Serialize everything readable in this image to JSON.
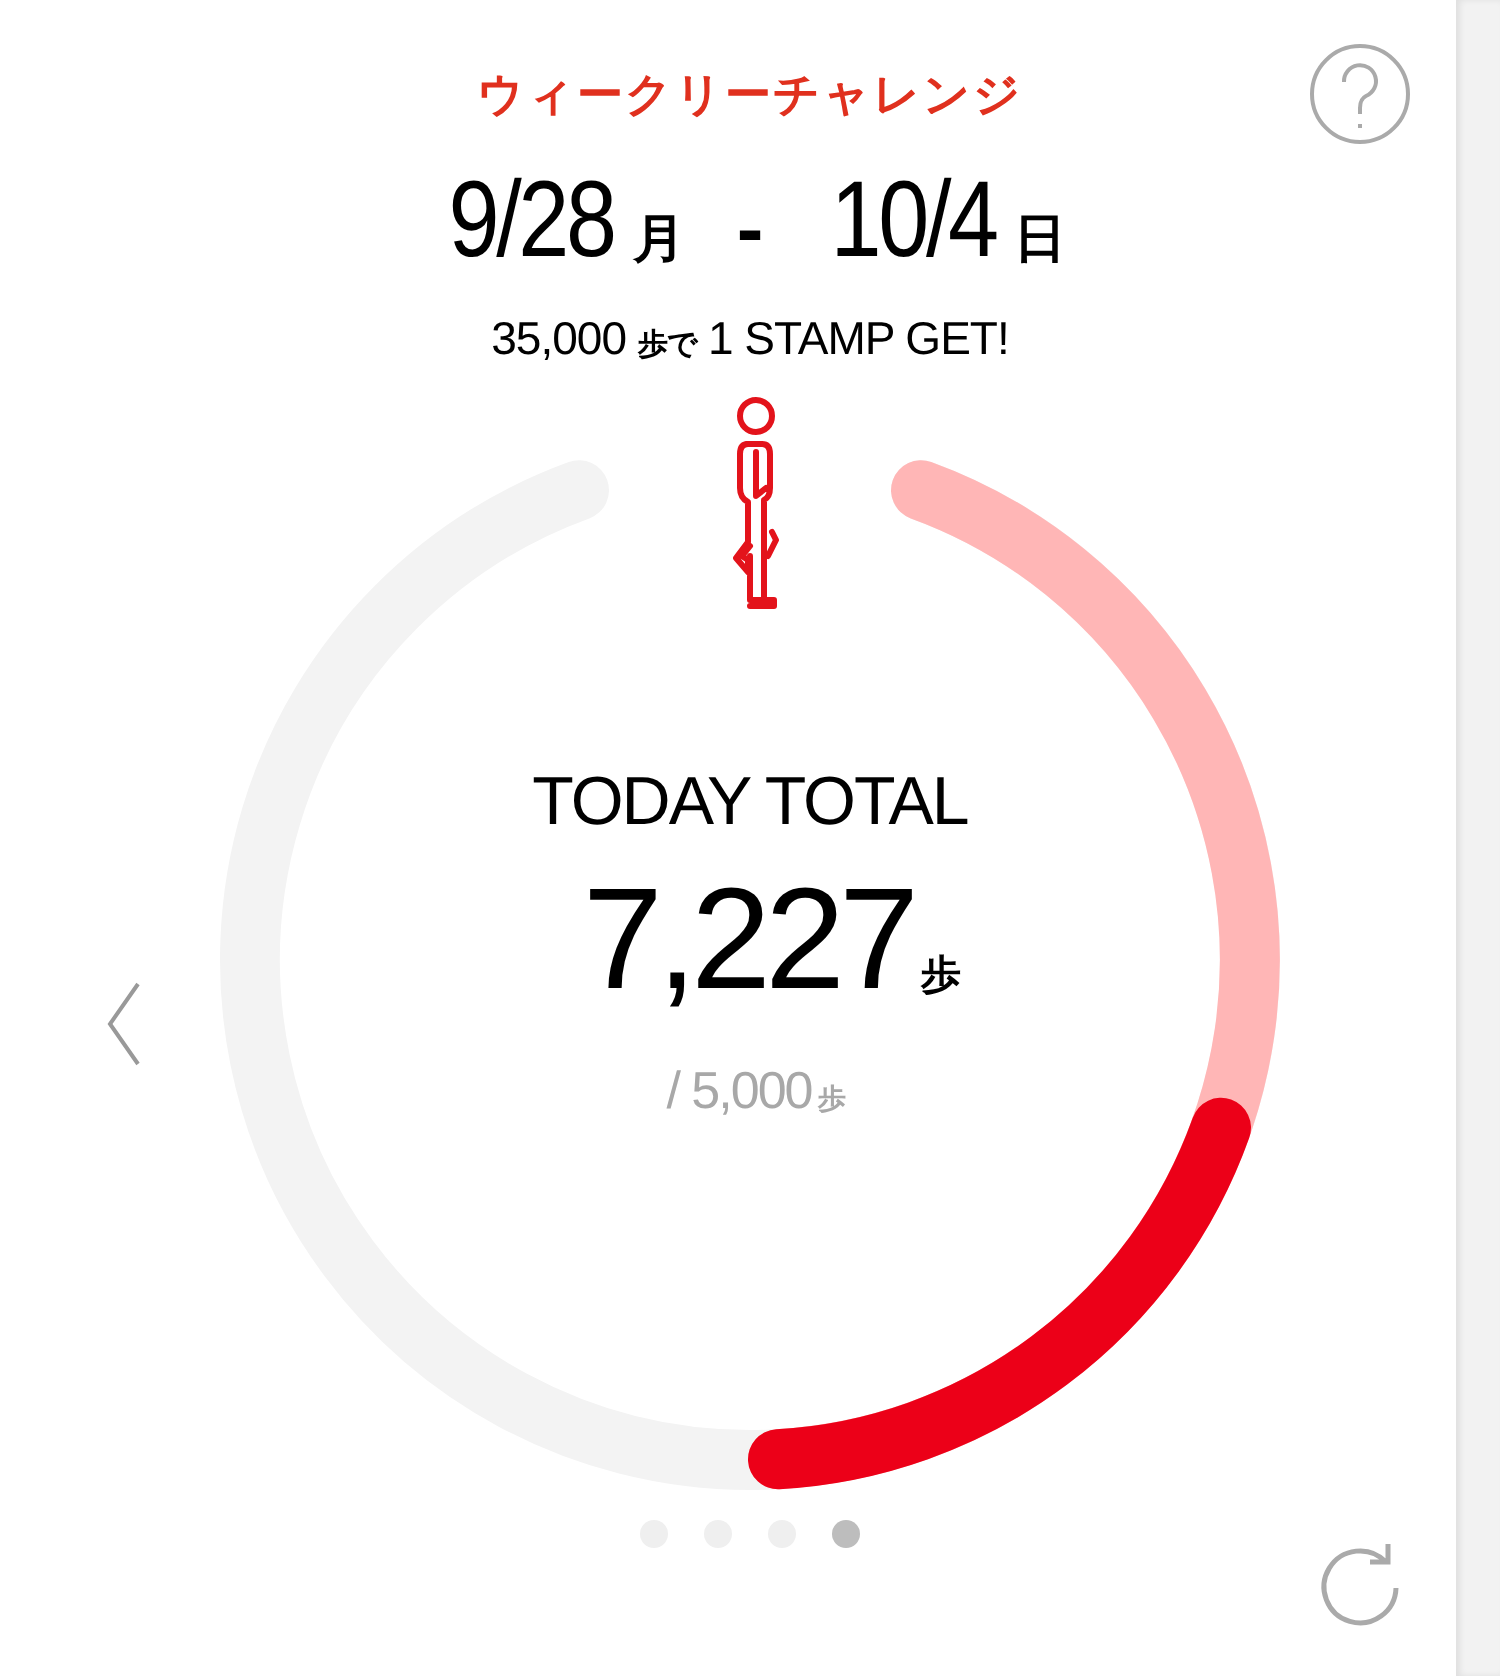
{
  "title": "ウィークリーチャレンジ",
  "date_range": {
    "start": "9/28",
    "start_day": "月",
    "separator": "-",
    "end": "10/4",
    "end_day": "日"
  },
  "goal": {
    "steps": "35,000",
    "unit": "歩で",
    "reward": "1 STAMP GET!"
  },
  "today": {
    "label": "TODAY TOTAL",
    "steps": "7,227",
    "unit": "歩",
    "target": "/ 5,000",
    "target_unit": "歩"
  },
  "pages": [
    {
      "selected": false
    },
    {
      "selected": false
    },
    {
      "selected": false
    },
    {
      "selected": true
    }
  ]
}
